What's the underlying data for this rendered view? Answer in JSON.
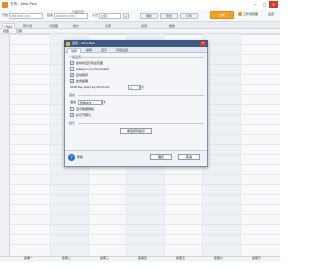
{
  "window": {
    "title": "方舟 - Ahoi-Plan",
    "minimize": "─",
    "maximize": "□",
    "close": "✕"
  },
  "toolbar": {
    "start_label": "开始",
    "start_value": "2018/01 (01)",
    "end_label": "结束",
    "end_value": "2018/01 (01)",
    "period_label": "日期范围",
    "staff_label": "人员",
    "staff_value": "全部",
    "add_button": "+",
    "primary_button": "分析",
    "links": [
      "工作流视图",
      "设置"
    ],
    "actions": [
      "刷新",
      "导出",
      "打印"
    ]
  },
  "tabs": [
    "日程表",
    "周计划",
    "月视图",
    "统计",
    "记录",
    "资源",
    "报告"
  ],
  "subtabs": [
    "视图",
    "日程"
  ],
  "day_labels": [
    "星期一",
    "星期二",
    "星期三",
    "星期四",
    "星期五",
    "星期六",
    "星期日"
  ],
  "dialog": {
    "title": "选项 - Ahoi-Plan",
    "tabs": [
      "常规",
      "编辑",
      "显示",
      "高级设置"
    ],
    "active_tab": 0,
    "group1_title": "一般设置",
    "checkboxes": [
      {
        "label": "启动时显示欢迎页面",
        "checked": true
      },
      {
        "label": "Always run minimized",
        "checked": false
      },
      {
        "label": "自动保存",
        "checked": true
      },
      {
        "label": "启用提醒",
        "checked": true
      }
    ],
    "shift_label": "Shift key start by Shortcut",
    "shift_value": "1",
    "group2_title": "语言",
    "language_label": "语言",
    "language_value": "简体中文",
    "checkboxes2": [
      {
        "label": "显示数据网格",
        "checked": false
      },
      {
        "label": "标记节假日",
        "checked": true
      }
    ],
    "group3_title": "提示",
    "tip_text": "重置所有提示",
    "help_label": "帮助",
    "ok_button": "确定",
    "cancel_button": "取消"
  }
}
